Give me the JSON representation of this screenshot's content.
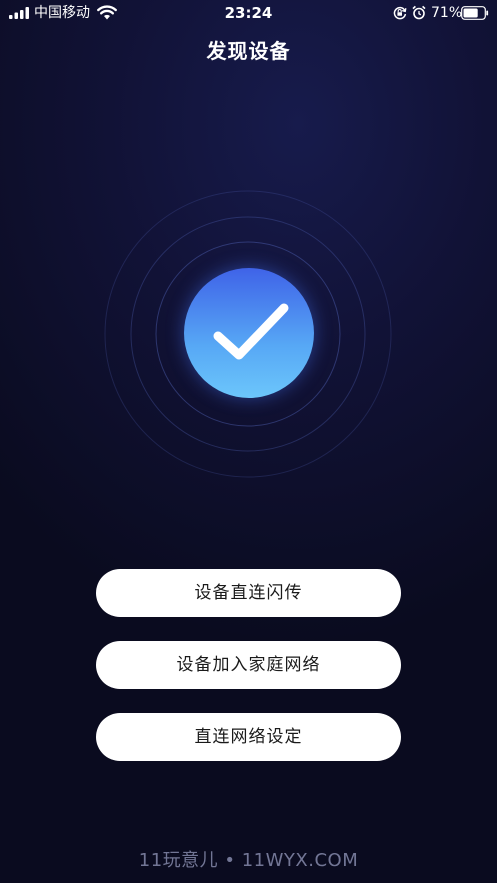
{
  "status_bar": {
    "carrier": "中国移动",
    "time": "23:24",
    "battery_percent": "71%",
    "battery_level": 0.71,
    "icons": [
      "signal-icon",
      "wifi-icon",
      "orientation-lock-icon",
      "alarm-icon",
      "battery-icon"
    ]
  },
  "header": {
    "title": "发现设备"
  },
  "main": {
    "status_icon": "checkmark-icon",
    "accent_color": "#4f8ff0",
    "buttons": [
      {
        "label": "设备直连闪传"
      },
      {
        "label": "设备加入家庭网络"
      },
      {
        "label": "直连网络设定"
      }
    ]
  },
  "watermark": {
    "text": "11玩意儿 • 11WYX.COM"
  }
}
